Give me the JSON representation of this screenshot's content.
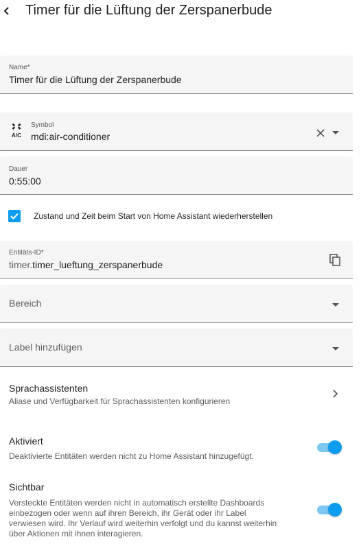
{
  "header": {
    "title": "Timer für die Lüftung der Zerspanerbude"
  },
  "name_field": {
    "label": "Name*",
    "value": "Timer für die Lüftung der Zerspanerbude"
  },
  "symbol_field": {
    "label": "Symbol",
    "value": "mdi:air-conditioner",
    "icon": "air-conditioner-icon"
  },
  "duration_field": {
    "label": "Dauer",
    "value": "0:55:00"
  },
  "restore_checkbox": {
    "label": "Zustand und Zeit beim Start von Home Assistant wiederherstellen",
    "checked": true
  },
  "entity_id_field": {
    "label": "Entitäts-ID*",
    "prefix": "timer.",
    "value": "timer_lueftung_zerspanerbude"
  },
  "area_field": {
    "placeholder": "Bereich"
  },
  "labels_field": {
    "placeholder": "Label hinzufügen"
  },
  "voice_assistants": {
    "title": "Sprachassistenten",
    "subtitle": "Aliase und Verfügbarkeit für Sprachassistenten konfigurieren"
  },
  "enabled": {
    "title": "Aktiviert",
    "subtitle": "Deaktivierte Entitäten werden nicht zu Home Assistant hinzugefügt.",
    "on": true
  },
  "visible": {
    "title": "Sichtbar",
    "subtitle_lines": [
      "Versteckte Entitäten werden nicht in automatisch erstellte Dashboards",
      "einbezogen oder wenn auf ihren Bereich, ihr Gerät oder ihr Label",
      "verwiesen wird. Ihr Verlauf wird weiterhin verfolgt und du kannst weiterhin",
      "über Aktionen mit ihnen interagieren."
    ],
    "on": true
  },
  "colors": {
    "accent": "#0d9cf0",
    "toggle_track": "#7dc8f2",
    "field_bg": "#f5f5f5"
  }
}
